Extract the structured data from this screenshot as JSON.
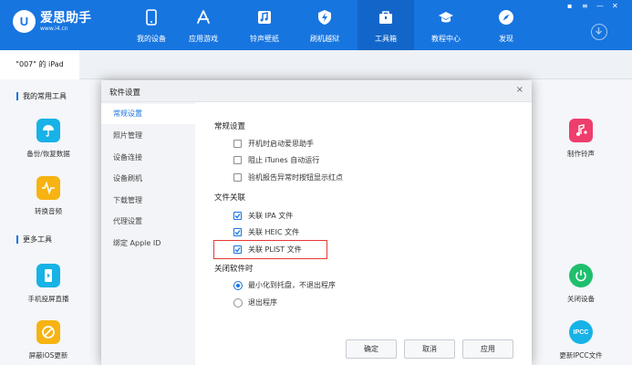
{
  "app": {
    "logo_mark": "U",
    "name": "爱思助手",
    "url": "www.i4.cn"
  },
  "nav": [
    {
      "label": "我的设备",
      "icon": "phone-icon"
    },
    {
      "label": "应用游戏",
      "icon": "app-store-icon"
    },
    {
      "label": "铃声壁纸",
      "icon": "ringtone-icon"
    },
    {
      "label": "刷机越狱",
      "icon": "flash-icon"
    },
    {
      "label": "工具箱",
      "icon": "toolbox-icon",
      "active": true
    },
    {
      "label": "教程中心",
      "icon": "graduation-cap-icon"
    },
    {
      "label": "发现",
      "icon": "compass-icon"
    }
  ],
  "device_tab": "\"007\" 的 iPad",
  "sections": {
    "common": "我的常用工具",
    "more": "更多工具"
  },
  "tools": {
    "backup": "备份/恢复数据",
    "ringtone": "制作铃声",
    "convert_audio": "转换音频",
    "screen_cast": "手机投屏直播",
    "shutdown": "关闭设备",
    "block_update": "屏蔽iOS更新",
    "ipcc": "更新IPCC文件",
    "ipcc_icon_text": "IPCC"
  },
  "dialog": {
    "title": "软件设置",
    "close": "×",
    "sidebar": [
      "常规设置",
      "照片管理",
      "设备连接",
      "设备刷机",
      "下载管理",
      "代理设置",
      "绑定 Apple ID"
    ],
    "general": {
      "title": "常规设置",
      "options": [
        {
          "label": "开机时启动爱思助手",
          "checked": false
        },
        {
          "label": "阻止 iTunes 自动运行",
          "checked": false
        },
        {
          "label": "验机报告异常时按钮显示红点",
          "checked": false
        }
      ]
    },
    "assoc": {
      "title": "文件关联",
      "options": [
        {
          "label": "关联 IPA 文件",
          "checked": true
        },
        {
          "label": "关联 HEIC 文件",
          "checked": true
        },
        {
          "label": "关联 PLIST 文件",
          "checked": true
        }
      ]
    },
    "close_behavior": {
      "title": "关闭软件时",
      "options": [
        {
          "label": "最小化到托盘，不退出程序",
          "selected": true
        },
        {
          "label": "退出程序",
          "selected": false
        }
      ]
    },
    "buttons": {
      "ok": "确定",
      "cancel": "取消",
      "apply": "应用"
    }
  },
  "colors": {
    "brand": "#1775e0",
    "nav_active": "#1366c9",
    "highlight": "#e53935"
  }
}
